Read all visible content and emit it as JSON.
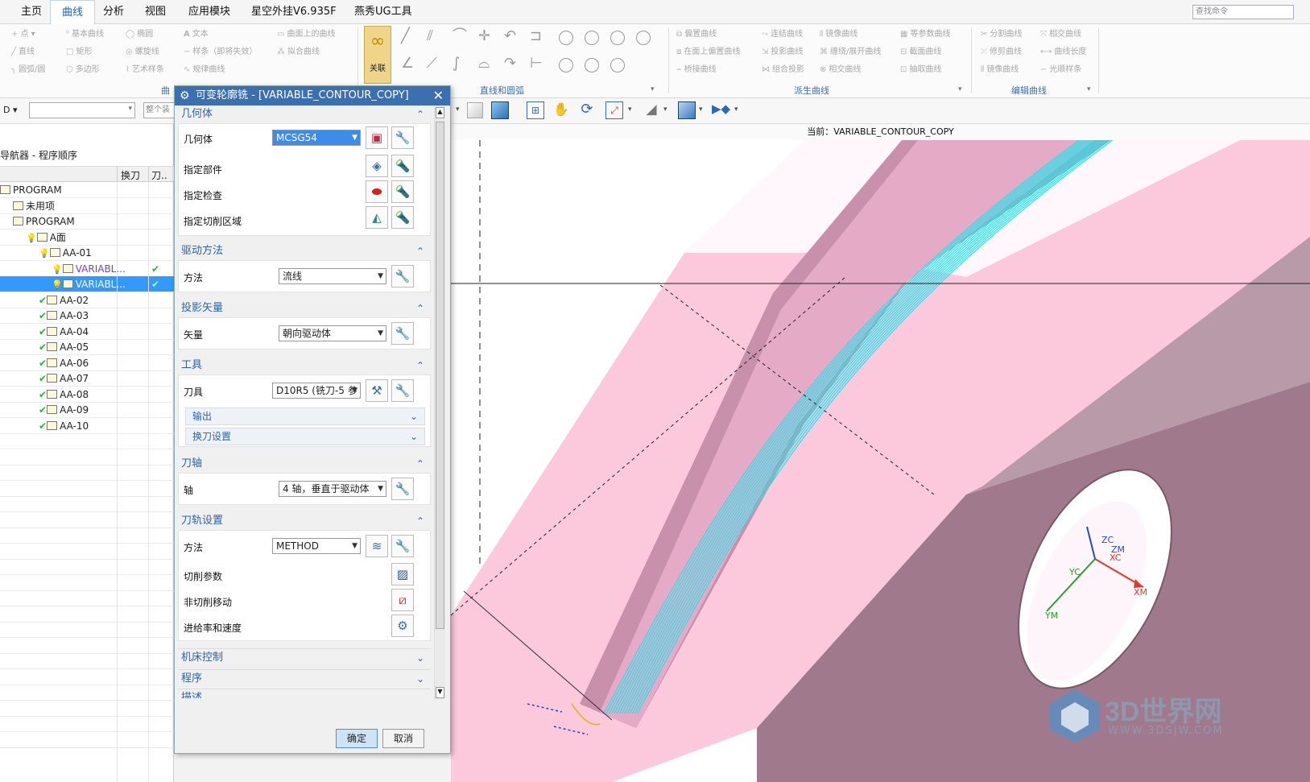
{
  "menu": {
    "tabs": [
      "主页",
      "曲线",
      "分析",
      "视图",
      "应用模块",
      "星空外挂V6.935F",
      "燕秀UG工具"
    ],
    "active_tab": "曲线",
    "search_placeholder": "查找命令"
  },
  "ribbon": {
    "curve_group": {
      "items": [
        "点",
        "基本曲线",
        "椭圆",
        "文本",
        "曲面上的曲线",
        "直线",
        "矩形",
        "螺旋线",
        "样条（即将失效）",
        "拟合曲线",
        "圆弧/圆",
        "多边形",
        "艺术样条",
        "规律曲线"
      ],
      "label": "曲"
    },
    "assoc_label": "关联",
    "line_arc_label": "直线和圆弧",
    "derived_group": {
      "items": [
        "偏置曲线",
        "连结曲线",
        "镜像曲线",
        "等参数曲线",
        "在面上偏置曲线",
        "投影曲线",
        "缠绕/展开曲线",
        "截面曲线",
        "桥接曲线",
        "组合投影",
        "相交曲线",
        "抽取曲线"
      ],
      "label": "派生曲线"
    },
    "edit_group": {
      "items": [
        "分割曲线",
        "相交曲线",
        "修剪曲线",
        "曲线长度",
        "镜像曲线",
        "光顺样条"
      ],
      "label": "编辑曲线"
    }
  },
  "toolbar2": {
    "left_label": "D",
    "filter_placeholder": "整个装"
  },
  "navigator": {
    "title": "导航器 - 程序顺序",
    "columns": [
      "换刀",
      "刀.."
    ],
    "rows": [
      {
        "name": "PROGRAM",
        "indent": 0,
        "state": ""
      },
      {
        "name": "未用项",
        "indent": 1,
        "state": ""
      },
      {
        "name": "PROGRAM",
        "indent": 1,
        "state": ""
      },
      {
        "name": "A面",
        "indent": 2,
        "state": "bulb"
      },
      {
        "name": "AA-01",
        "indent": 3,
        "state": "bulb"
      },
      {
        "name": "VARIABL...",
        "indent": 4,
        "state": "bulb",
        "col2": "✔"
      },
      {
        "name": "VARIABL...",
        "indent": 4,
        "state": "bulb",
        "col2": "✔",
        "selected": true
      },
      {
        "name": "AA-02",
        "indent": 3,
        "state": "tick"
      },
      {
        "name": "AA-03",
        "indent": 3,
        "state": "tick"
      },
      {
        "name": "AA-04",
        "indent": 3,
        "state": "tick"
      },
      {
        "name": "AA-05",
        "indent": 3,
        "state": "tick"
      },
      {
        "name": "AA-06",
        "indent": 3,
        "state": "tick"
      },
      {
        "name": "AA-07",
        "indent": 3,
        "state": "tick"
      },
      {
        "name": "AA-08",
        "indent": 3,
        "state": "tick"
      },
      {
        "name": "AA-09",
        "indent": 3,
        "state": "tick"
      },
      {
        "name": "AA-10",
        "indent": 3,
        "state": "tick"
      }
    ]
  },
  "dialog": {
    "title": "可变轮廓铣 - [VARIABLE_CONTOUR_COPY]",
    "geometry": {
      "header": "几何体",
      "geometry_label": "几何体",
      "geometry_value": "MCSG54",
      "part_label": "指定部件",
      "check_label": "指定检查",
      "cut_area_label": "指定切削区域"
    },
    "drive": {
      "header": "驱动方法",
      "method_label": "方法",
      "method_value": "流线"
    },
    "projection": {
      "header": "投影矢量",
      "vector_label": "矢量",
      "vector_value": "朝向驱动体"
    },
    "tool": {
      "header": "工具",
      "tool_label": "刀具",
      "tool_value": "D10R5 (铣刀-5 参",
      "output_label": "输出",
      "change_label": "换刀设置"
    },
    "axis": {
      "header": "刀轴",
      "axis_label": "轴",
      "axis_value": "4 轴，垂直于驱动体"
    },
    "path": {
      "header": "刀轨设置",
      "method_label": "方法",
      "method_value": "METHOD",
      "cut_params": "切削参数",
      "noncut": "非切削移动",
      "feeds": "进给率和速度"
    },
    "machine_header": "机床控制",
    "program_header": "程序",
    "desc_header": "描述",
    "ok": "确定",
    "cancel": "取消"
  },
  "viewport": {
    "title": "当前：VARIABLE_CONTOUR_COPY",
    "axes": [
      "ZC",
      "ZM",
      "XC",
      "YC",
      "XM",
      "YM"
    ],
    "colors": {
      "part_face": "#fbc8dc",
      "part_side": "#a67e90",
      "toolpath": "#20e6f0",
      "dark": "#a07a8c"
    }
  },
  "watermark": {
    "logo_text": "3D世界网",
    "url": "WWW.3DSJW.COM"
  }
}
